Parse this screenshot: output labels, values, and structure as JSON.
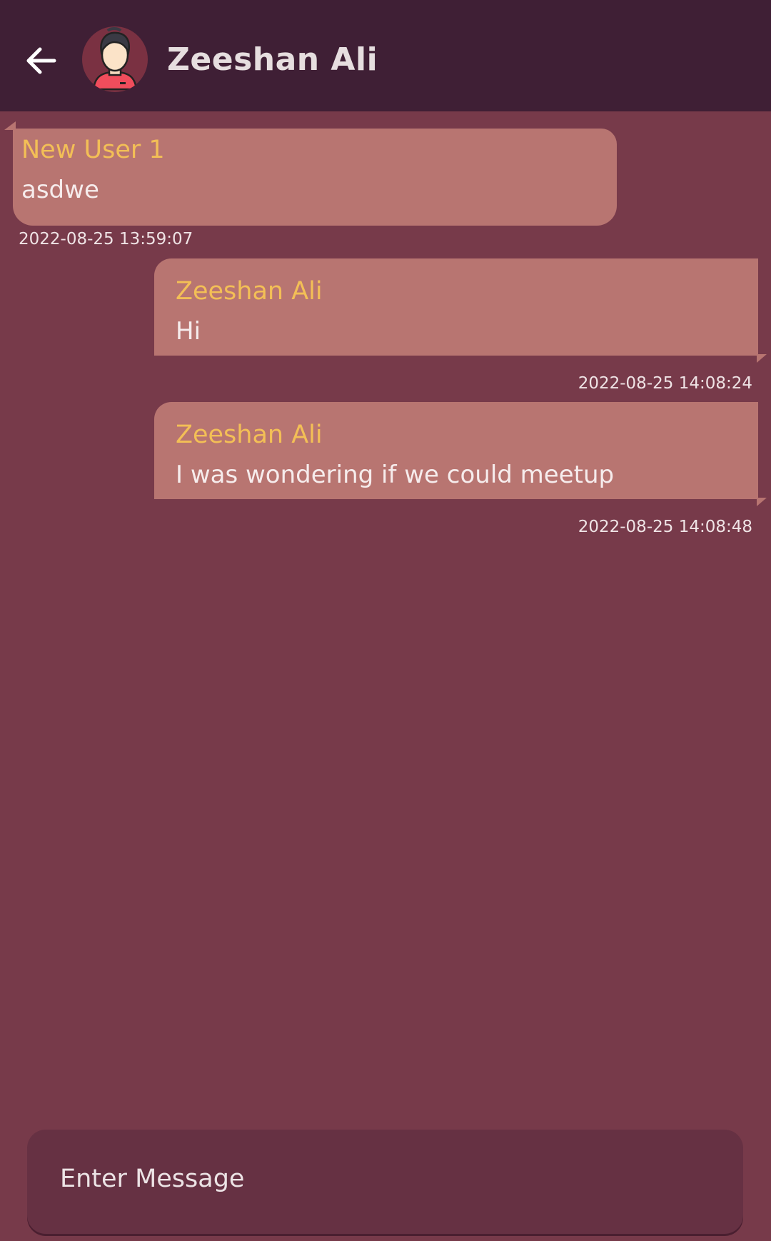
{
  "header": {
    "contact_name": "Zeeshan Ali",
    "back_icon": "arrow-left-icon",
    "avatar_icon": "user-avatar-icon"
  },
  "messages": [
    {
      "direction": "incoming",
      "sender": "New User 1",
      "text": "asdwe",
      "timestamp": "2022-08-25 13:59:07"
    },
    {
      "direction": "outgoing",
      "sender": "Zeeshan Ali",
      "text": "Hi",
      "timestamp": "2022-08-25 14:08:24"
    },
    {
      "direction": "outgoing",
      "sender": "Zeeshan Ali",
      "text": "I was wondering if we could meetup",
      "timestamp": "2022-08-25 14:08:48"
    }
  ],
  "composer": {
    "placeholder": "Enter Message",
    "value": ""
  },
  "colors": {
    "app_bar": "#3f1f35",
    "background": "#773a4a",
    "bubble": "#b87571",
    "sender_name": "#f3bf56",
    "composer": "#663143"
  }
}
